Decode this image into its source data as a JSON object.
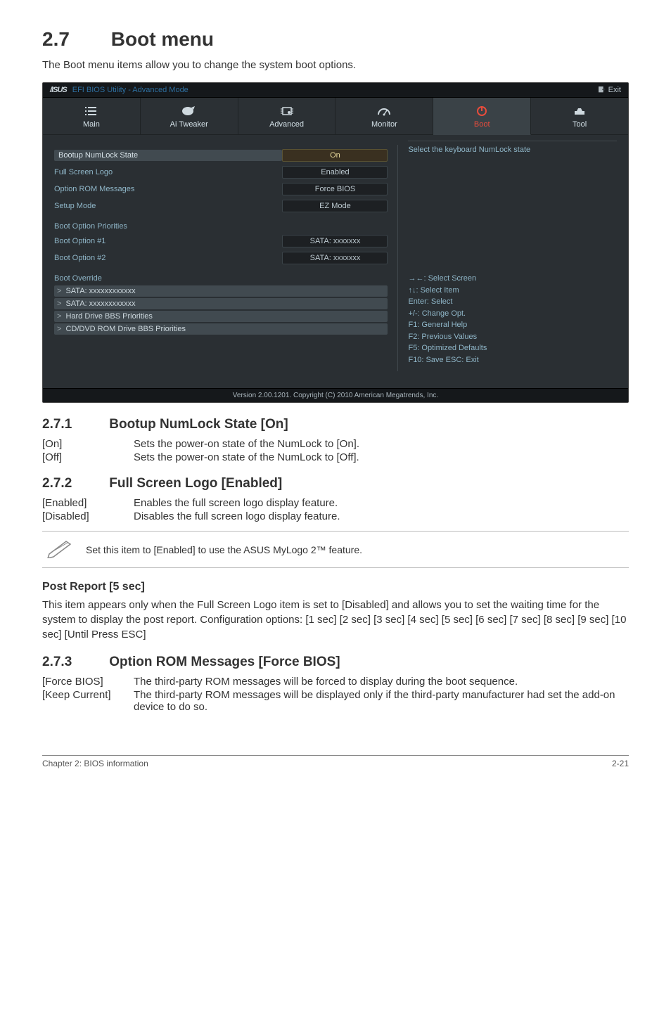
{
  "page": {
    "section_num": "2.7",
    "section_title": "Boot menu",
    "intro": "The Boot menu items allow you to change the system boot options."
  },
  "bios": {
    "logo": "/ISUS",
    "topbar_title": "EFI BIOS Utility - Advanced Mode",
    "exit_label": "Exit",
    "tabs": [
      {
        "label": "Main"
      },
      {
        "label": "Ai  Tweaker"
      },
      {
        "label": "Advanced"
      },
      {
        "label": "Monitor"
      },
      {
        "label": "Boot"
      },
      {
        "label": "Tool"
      }
    ],
    "right_hint_top": "Select the keyboard NumLock state",
    "fields": {
      "numlock_label": "Bootup NumLock State",
      "numlock_value": "On",
      "fullscreen_label": "Full Screen Logo",
      "fullscreen_value": "Enabled",
      "optionrom_label": "Option ROM Messages",
      "optionrom_value": "Force BIOS",
      "setupmode_label": "Setup Mode",
      "setupmode_value": "EZ Mode"
    },
    "priorities_header": "Boot Option Priorities",
    "boot1_label": "Boot Option #1",
    "boot1_value": "SATA: xxxxxxx",
    "boot2_label": "Boot Option #2",
    "boot2_value": "SATA: xxxxxxx",
    "override_header": "Boot Override",
    "override_items": [
      "SATA: xxxxxxxxxxxx",
      "SATA: xxxxxxxxxxxx",
      "Hard Drive BBS Priorities",
      "CD/DVD ROM Drive BBS Priorities"
    ],
    "nav_hints": [
      "→←:  Select Screen",
      "↑↓:  Select Item",
      "Enter:  Select",
      "+/-:  Change Opt.",
      "F1:  General Help",
      "F2:  Previous Values",
      "F5:  Optimized Defaults",
      "F10:  Save   ESC:  Exit"
    ],
    "footer": "Version  2.00.1201.   Copyright  (C)  2010  American  Megatrends,  Inc."
  },
  "sub271": {
    "num": "2.7.1",
    "title": "Bootup NumLock State [On]",
    "rows": [
      {
        "key": "[On]",
        "val": "Sets the power-on state of the NumLock to [On]."
      },
      {
        "key": "[Off]",
        "val": "Sets the power-on state of the NumLock to [Off]."
      }
    ]
  },
  "sub272": {
    "num": "2.7.2",
    "title": "Full Screen Logo [Enabled]",
    "rows": [
      {
        "key": "[Enabled]",
        "val": "Enables the full screen logo display feature."
      },
      {
        "key": "[Disabled]",
        "val": "Disables the full screen logo display feature."
      }
    ],
    "note": "Set this item to [Enabled] to use the ASUS MyLogo 2™ feature."
  },
  "post_report": {
    "heading": "Post Report [5 sec]",
    "body": "This item appears only when the Full Screen Logo item is set to [Disabled] and allows you to set the waiting time for the system to display the post report. Configuration options: [1 sec] [2 sec] [3 sec] [4 sec] [5 sec] [6 sec] [7 sec] [8 sec] [9 sec] [10 sec] [Until Press ESC]"
  },
  "sub273": {
    "num": "2.7.3",
    "title": "Option ROM Messages [Force BIOS]",
    "rows": [
      {
        "key": "[Force BIOS]",
        "val": "The third-party ROM messages will be forced to display during the boot sequence."
      },
      {
        "key": "[Keep Current]",
        "val": "The third-party ROM messages will be displayed only if the third-party manufacturer had set the add-on device to do so."
      }
    ]
  },
  "footer": {
    "left": "Chapter 2: BIOS information",
    "right": "2-21"
  }
}
